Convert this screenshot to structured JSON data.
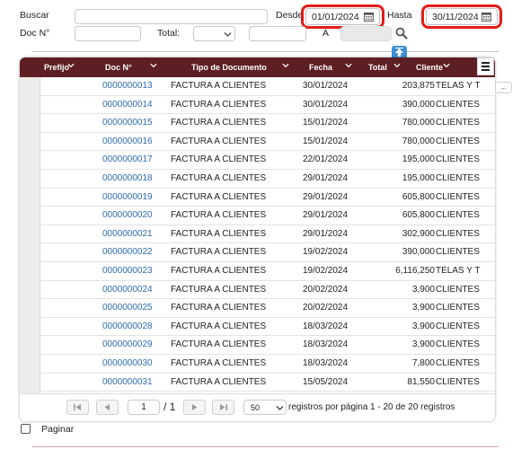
{
  "filters": {
    "buscar_label": "Buscar",
    "buscar_value": "",
    "desde_label": "Desde",
    "desde_value": "01/01/2024",
    "hasta_label": "Hasta",
    "hasta_value": "30/11/2024",
    "docno_label": "Doc N°",
    "docno_value": "",
    "total_label": "Total:",
    "total_operator": "",
    "total_value": "",
    "a_label": "A",
    "a_value": ""
  },
  "grid": {
    "columns": [
      "Prefijo",
      "Doc N°",
      "Tipo de Documento",
      "Fecha",
      "Total",
      "Cliente"
    ],
    "rows": [
      {
        "doc": "0000000013",
        "tipo": "FACTURA A CLIENTES",
        "fecha": "30/01/2024",
        "total": "203,875",
        "cliente": "TELAS Y T"
      },
      {
        "doc": "0000000014",
        "tipo": "FACTURA A CLIENTES",
        "fecha": "30/01/2024",
        "total": "390,000",
        "cliente": "CLIENTES"
      },
      {
        "doc": "0000000015",
        "tipo": "FACTURA A CLIENTES",
        "fecha": "15/01/2024",
        "total": "780,000",
        "cliente": "CLIENTES"
      },
      {
        "doc": "0000000016",
        "tipo": "FACTURA A CLIENTES",
        "fecha": "15/01/2024",
        "total": "780,000",
        "cliente": "CLIENTES"
      },
      {
        "doc": "0000000017",
        "tipo": "FACTURA A CLIENTES",
        "fecha": "22/01/2024",
        "total": "195,000",
        "cliente": "CLIENTES"
      },
      {
        "doc": "0000000018",
        "tipo": "FACTURA A CLIENTES",
        "fecha": "29/01/2024",
        "total": "195,000",
        "cliente": "CLIENTES"
      },
      {
        "doc": "0000000019",
        "tipo": "FACTURA A CLIENTES",
        "fecha": "29/01/2024",
        "total": "605,800",
        "cliente": "CLIENTES"
      },
      {
        "doc": "0000000020",
        "tipo": "FACTURA A CLIENTES",
        "fecha": "29/01/2024",
        "total": "605,800",
        "cliente": "CLIENTES"
      },
      {
        "doc": "0000000021",
        "tipo": "FACTURA A CLIENTES",
        "fecha": "29/01/2024",
        "total": "302,900",
        "cliente": "CLIENTES"
      },
      {
        "doc": "0000000022",
        "tipo": "FACTURA A CLIENTES",
        "fecha": "19/02/2024",
        "total": "390,000",
        "cliente": "CLIENTES"
      },
      {
        "doc": "0000000023",
        "tipo": "FACTURA A CLIENTES",
        "fecha": "19/02/2024",
        "total": "6,116,250",
        "cliente": "TELAS Y T"
      },
      {
        "doc": "0000000024",
        "tipo": "FACTURA A CLIENTES",
        "fecha": "20/02/2024",
        "total": "3,900",
        "cliente": "CLIENTES"
      },
      {
        "doc": "0000000025",
        "tipo": "FACTURA A CLIENTES",
        "fecha": "20/02/2024",
        "total": "3,900",
        "cliente": "CLIENTES"
      },
      {
        "doc": "0000000028",
        "tipo": "FACTURA A CLIENTES",
        "fecha": "18/03/2024",
        "total": "3,900",
        "cliente": "CLIENTES"
      },
      {
        "doc": "0000000029",
        "tipo": "FACTURA A CLIENTES",
        "fecha": "18/03/2024",
        "total": "3,900",
        "cliente": "CLIENTES"
      },
      {
        "doc": "0000000030",
        "tipo": "FACTURA A CLIENTES",
        "fecha": "18/03/2024",
        "total": "7,800",
        "cliente": "CLIENTES"
      },
      {
        "doc": "0000000031",
        "tipo": "FACTURA A CLIENTES",
        "fecha": "15/05/2024",
        "total": "81,550",
        "cliente": "CLIENTES"
      }
    ],
    "ellipsis": "..."
  },
  "pager": {
    "page": "1",
    "of_label": "/ 1",
    "page_size": "50",
    "per_page_label": "registros por página",
    "summary": "1 - 20 de 20 registros"
  },
  "paginar_label": "Paginar",
  "colors": {
    "header_bg": "#5d1f24",
    "highlight": "#e41b17",
    "link": "#2b6cb0",
    "up_button": "#3d8fd6"
  },
  "icons": [
    "calendar-icon",
    "search-icon",
    "arrow-up-icon",
    "menu-icon",
    "chevron-down-icon",
    "first-page-icon",
    "prev-page-icon",
    "next-page-icon",
    "last-page-icon"
  ]
}
